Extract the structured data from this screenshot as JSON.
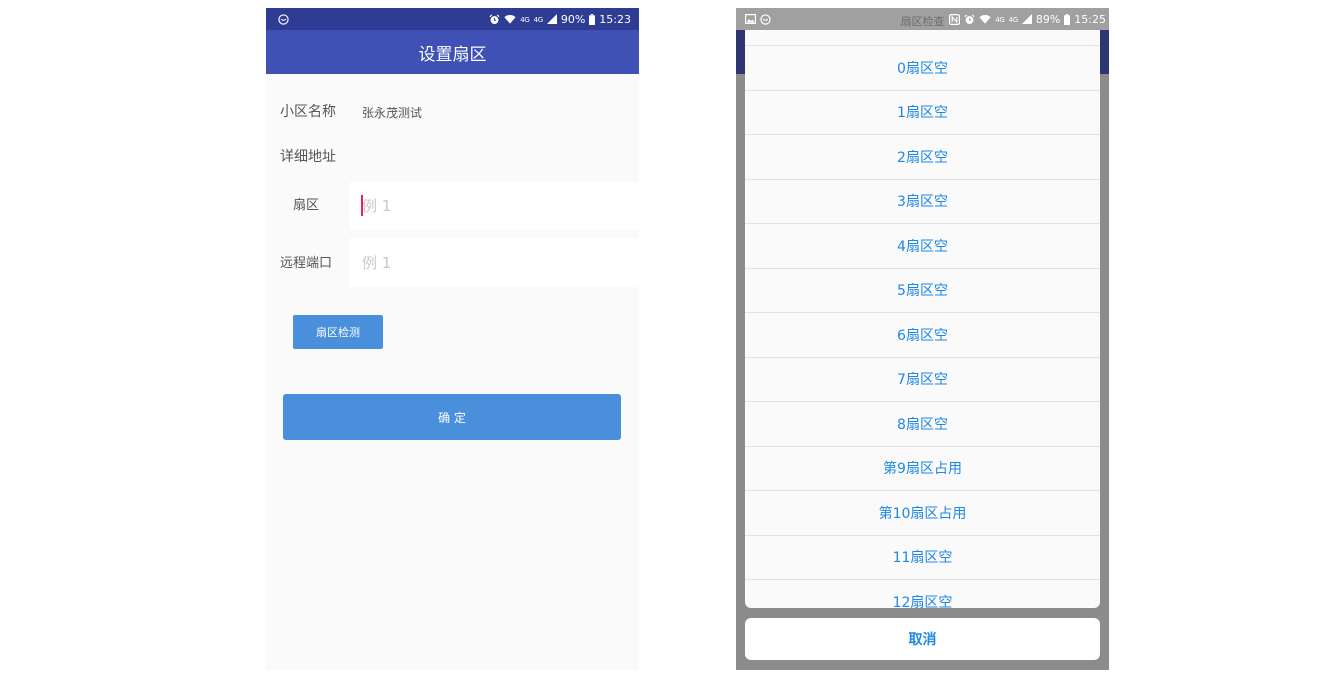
{
  "colors": {
    "status_bar_left": "#2f3c93",
    "app_bar": "#3f51b5",
    "button": "#4a8fdc",
    "list_text": "#1e88e5",
    "cursor": "#e91e63",
    "scrim": "#8c8c8c",
    "status_bar_right": "#a0a0a0",
    "app_bar_dimmed": "#2d3670"
  },
  "left_screen": {
    "status_bar": {
      "icons_left": [
        "app-notification-icon"
      ],
      "icons_right": [
        "alarm-icon",
        "wifi-icon",
        "signal-icon",
        "battery-icon"
      ],
      "network": "4G",
      "battery": "90%",
      "time": "15:23"
    },
    "app_bar": {
      "title": "设置扇区"
    },
    "form": {
      "community_label": "小区名称",
      "community_value": "张永茂测试",
      "address_label": "详细地址",
      "sector_label": "扇区",
      "sector_input": {
        "placeholder": "例 1",
        "focused": true
      },
      "port_label": "远程端口",
      "port_input": {
        "placeholder": "例 1"
      }
    },
    "check_button_label": "扇区检测",
    "confirm_button_label": "确 定"
  },
  "right_screen": {
    "status_bar": {
      "icons_left": [
        "image-notification-icon",
        "app-notification-icon"
      ],
      "icons_right": [
        "nfc-icon",
        "alarm-icon",
        "wifi-icon",
        "signal-icon",
        "battery-icon"
      ],
      "network": "4G",
      "battery": "89%",
      "time": "15:25"
    },
    "dialog": {
      "title": "扇区检查",
      "items": [
        "0扇区空",
        "1扇区空",
        "2扇区空",
        "3扇区空",
        "4扇区空",
        "5扇区空",
        "6扇区空",
        "7扇区空",
        "8扇区空",
        "第9扇区占用",
        "第10扇区占用",
        "11扇区空",
        "12扇区空"
      ],
      "cancel_label": "取消"
    }
  }
}
